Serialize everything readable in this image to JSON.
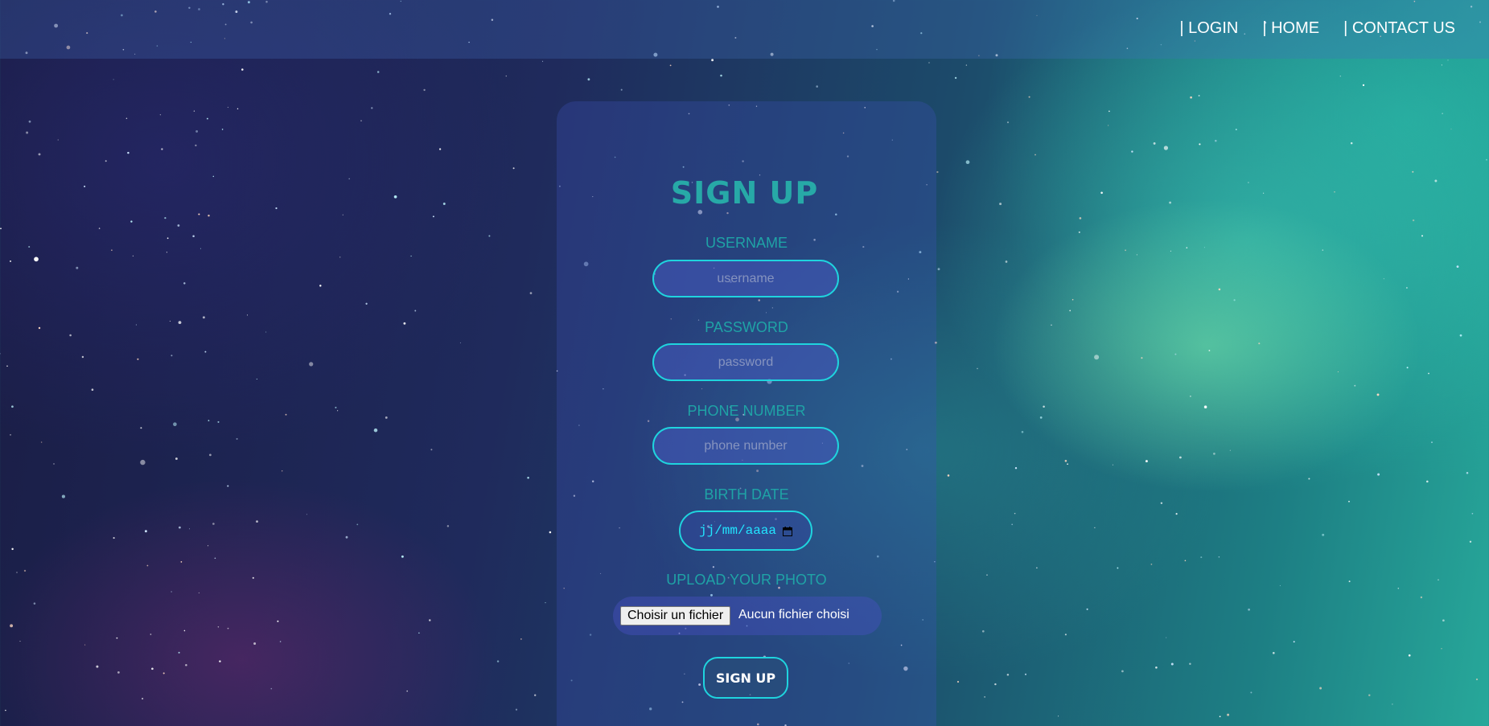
{
  "nav": {
    "links": [
      "| LOGIN",
      "| HOME",
      "| CONTACT US"
    ]
  },
  "form": {
    "title": "SIGN UP",
    "username": {
      "label": "USERNAME",
      "placeholder": "username",
      "value": ""
    },
    "password": {
      "label": "PASSWORD",
      "placeholder": "password",
      "value": ""
    },
    "phone": {
      "label": "PHONE NUMBER",
      "placeholder": "phone number",
      "value": ""
    },
    "birth_date": {
      "label": "BIRTH DATE",
      "placeholder": "jj/mm/aaaa"
    },
    "photo": {
      "label": "UPLOAD YOUR PHOTO",
      "button_label": "Choisir un fichier",
      "status": "Aucun fichier choisi"
    },
    "submit_label": "SIGN UP"
  },
  "colors": {
    "accent": "#1fd4de",
    "title": "#27a9a7",
    "label": "#1fa3a6",
    "date_text": "#22e5ff"
  }
}
